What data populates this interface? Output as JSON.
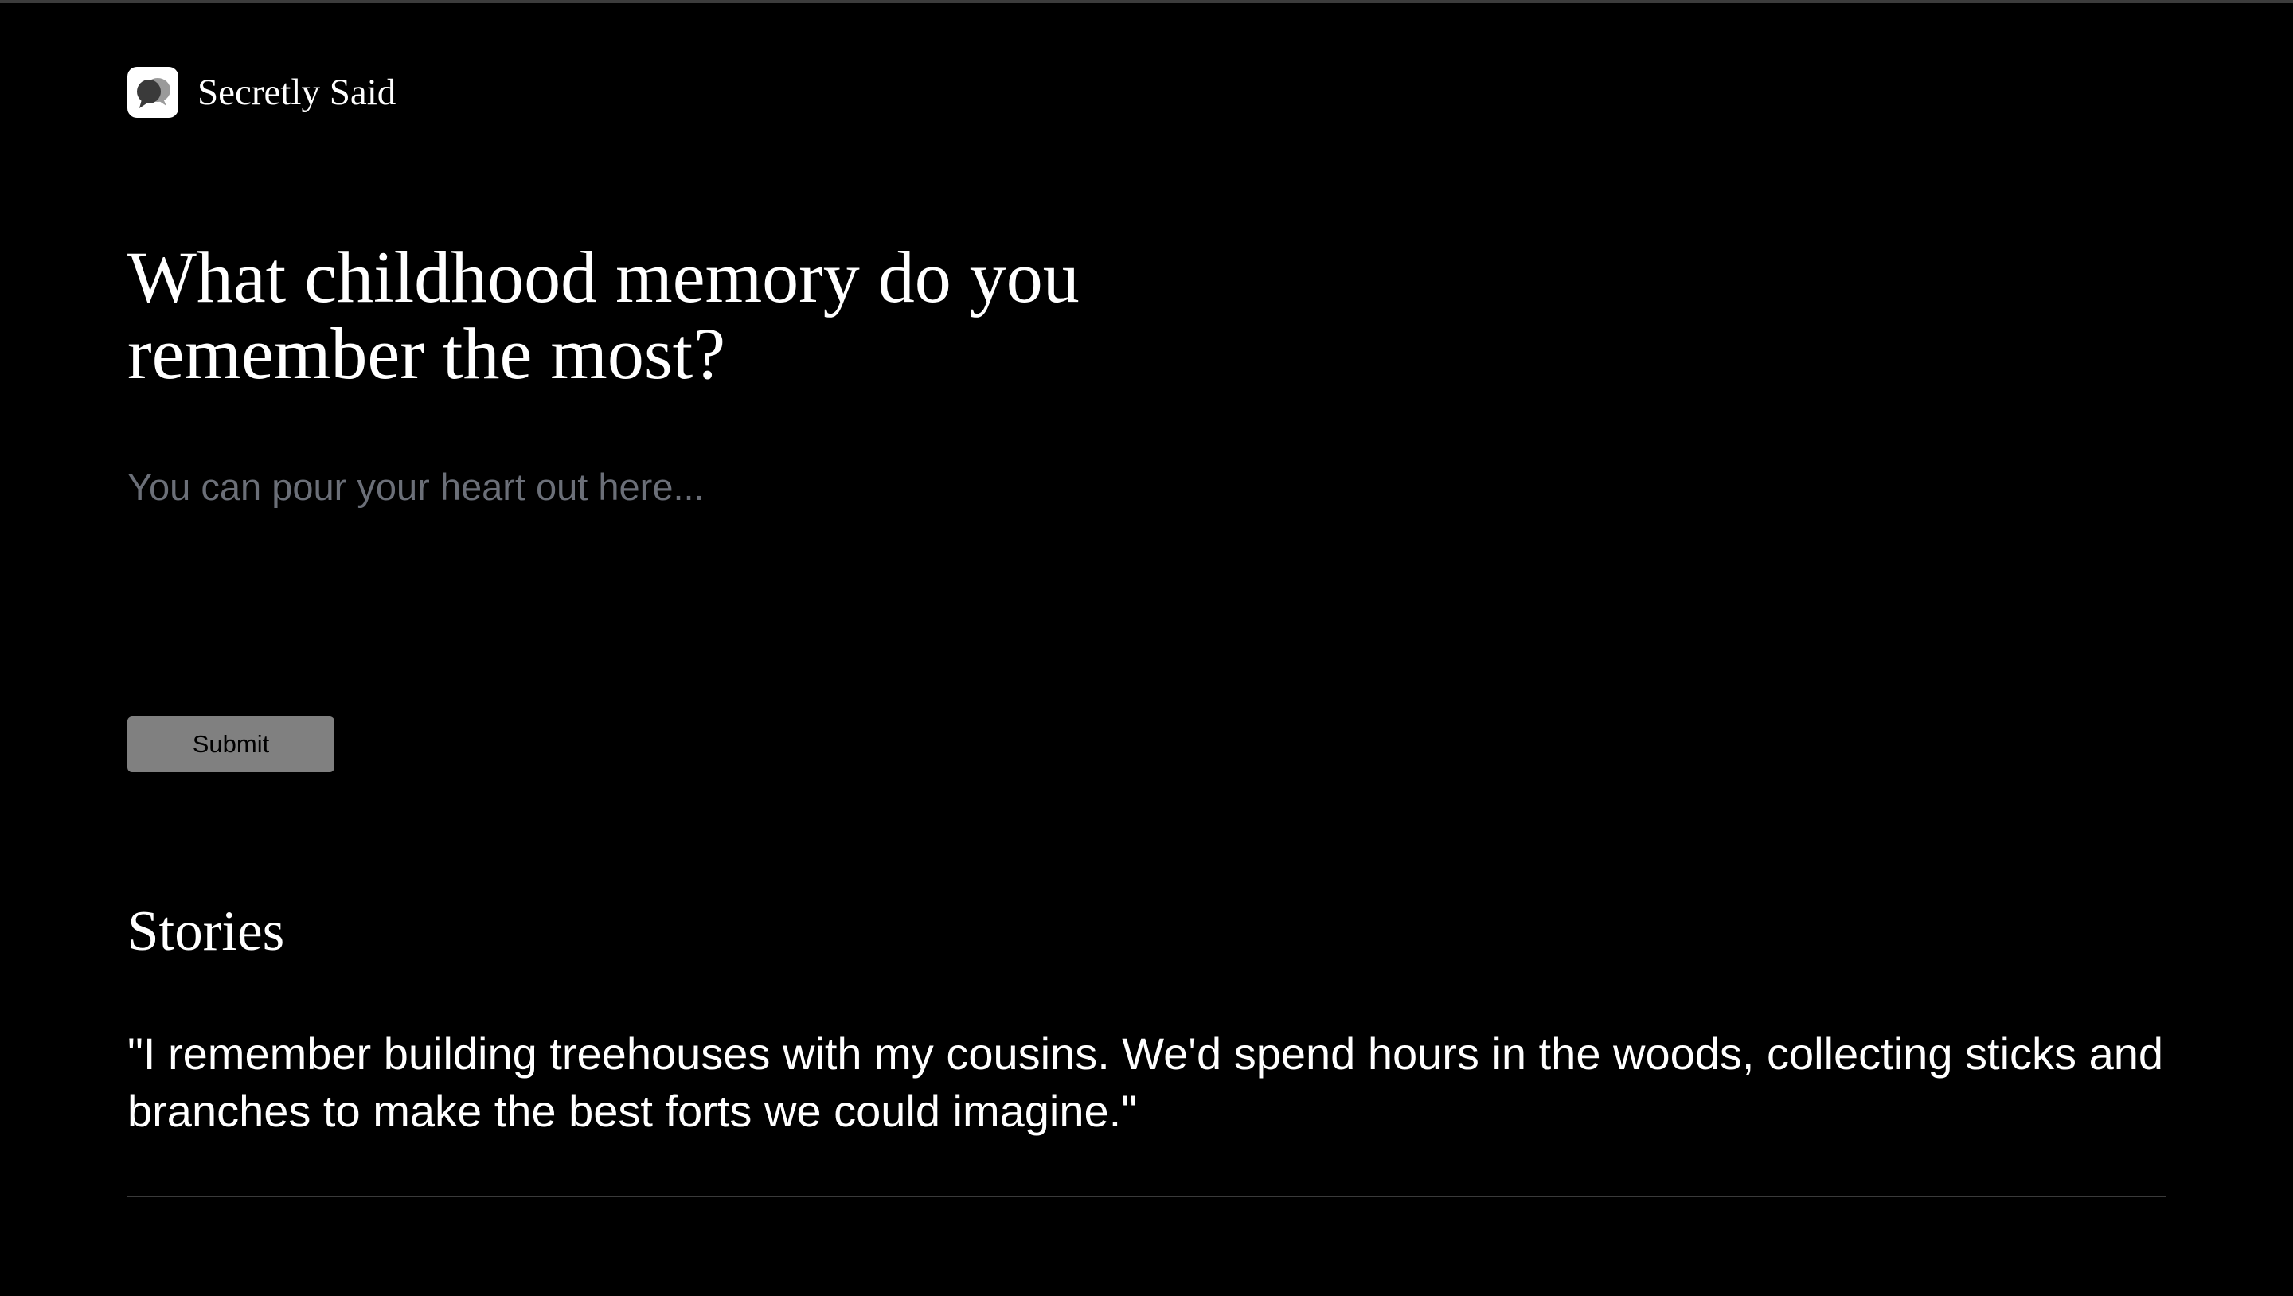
{
  "brand": {
    "name": "Secretly Said",
    "logo_icon": "speech-bubbles-icon"
  },
  "prompt": {
    "question": "What childhood memory do you remember the most?"
  },
  "answer": {
    "value": "",
    "placeholder": "You can pour your heart out here..."
  },
  "submit": {
    "label": "Submit"
  },
  "stories": {
    "heading": "Stories",
    "items": [
      {
        "text": "\"I remember building treehouses with my cousins. We'd spend hours in the woods, collecting sticks and branches to make the best forts we could imagine.\""
      }
    ]
  },
  "colors": {
    "background": "#000000",
    "text": "#ffffff",
    "placeholder": "#6b6f78",
    "button": "#808080",
    "divider": "#3a3a3a"
  }
}
